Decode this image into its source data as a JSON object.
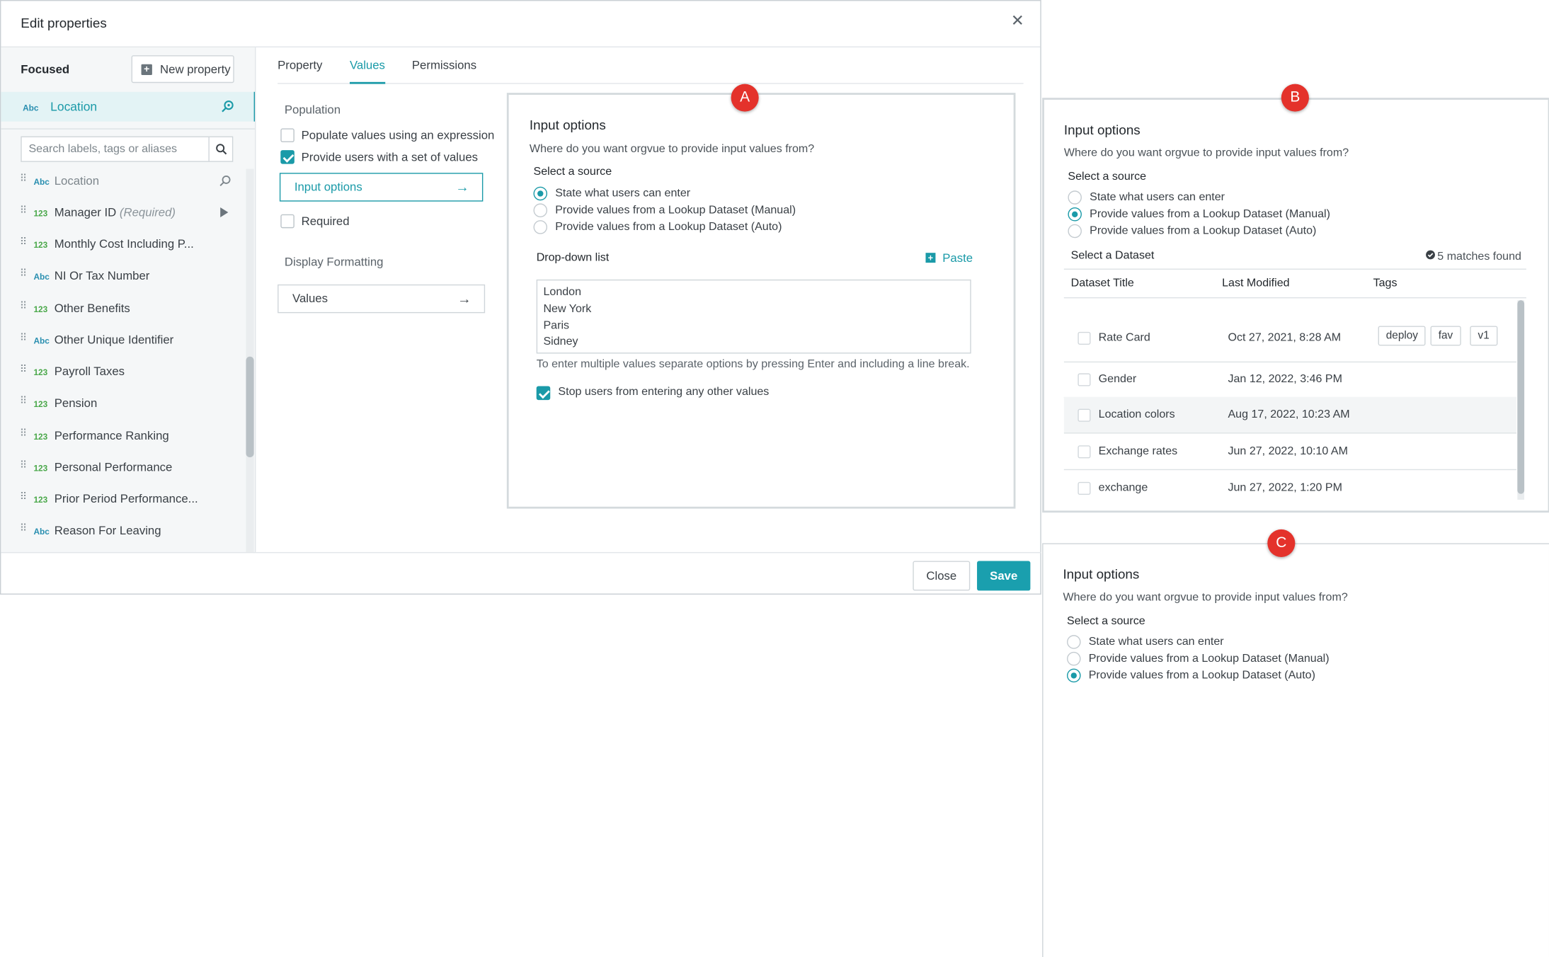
{
  "dialog": {
    "title": "Edit properties",
    "close_glyph": "✕"
  },
  "sidebar": {
    "focused_label": "Focused",
    "new_property_label": "New property",
    "focused_item": {
      "type": "Abc",
      "name": "Location"
    },
    "search_placeholder": "Search labels, tags or aliases",
    "items": [
      {
        "type": "Abc",
        "name": "Location",
        "muted": true
      },
      {
        "type": "123",
        "name": "Manager ID",
        "suffix": "(Required)"
      },
      {
        "type": "123",
        "name": "Monthly Cost Including P..."
      },
      {
        "type": "Abc",
        "name": "NI Or Tax Number"
      },
      {
        "type": "123",
        "name": "Other Benefits"
      },
      {
        "type": "Abc",
        "name": "Other Unique Identifier"
      },
      {
        "type": "123",
        "name": "Payroll Taxes"
      },
      {
        "type": "123",
        "name": "Pension"
      },
      {
        "type": "123",
        "name": "Performance Ranking"
      },
      {
        "type": "123",
        "name": "Personal Performance"
      },
      {
        "type": "123",
        "name": "Prior Period Performance..."
      },
      {
        "type": "Abc",
        "name": "Reason For Leaving"
      }
    ]
  },
  "tabs": [
    "Property",
    "Values",
    "Permissions"
  ],
  "active_tab": "Values",
  "population": {
    "title": "Population",
    "expression_label": "Populate values using an expression",
    "set_label": "Provide users with a set of values",
    "input_options_btn": "Input options",
    "required_label": "Required",
    "display_formatting_title": "Display Formatting",
    "values_btn": "Values"
  },
  "panel_a": {
    "marker": "A",
    "title": "Input options",
    "subtitle": "Where do you want orgvue to provide input values from?",
    "source_label": "Select a source",
    "options": [
      "State what users can enter",
      "Provide values from a Lookup Dataset (Manual)",
      "Provide values from a Lookup Dataset (Auto)"
    ],
    "selected_index": 0,
    "dropdown_label": "Drop-down list",
    "paste_label": "Paste",
    "dropdown_values": [
      "London",
      "New York",
      "Paris",
      "Sidney"
    ],
    "hint": "To enter multiple values separate options by pressing Enter and including a line break.",
    "stop_label": "Stop users from entering any other values"
  },
  "panel_b": {
    "marker": "B",
    "title": "Input options",
    "subtitle": "Where do you want orgvue to provide input values from?",
    "source_label": "Select a source",
    "options": [
      "State what users can enter",
      "Provide values from a Lookup Dataset (Manual)",
      "Provide values from a Lookup Dataset (Auto)"
    ],
    "selected_index": 1,
    "dataset_label": "Select a Dataset",
    "matches": "5 matches found",
    "columns": [
      "Dataset Title",
      "Last Modified",
      "Tags"
    ],
    "rows": [
      {
        "title": "Rate Card",
        "modified": "Oct 27, 2021, 8:28 AM",
        "tags": [
          "deploy",
          "fav",
          "v1"
        ]
      },
      {
        "title": "Gender",
        "modified": "Jan 12, 2022, 3:46 PM",
        "tags": []
      },
      {
        "title": "Location colors",
        "modified": "Aug 17, 2022, 10:23 AM",
        "tags": []
      },
      {
        "title": "Exchange rates",
        "modified": "Jun 27, 2022, 10:10 AM",
        "tags": []
      },
      {
        "title": "exchange",
        "modified": "Jun 27, 2022, 1:20 PM",
        "tags": []
      }
    ]
  },
  "panel_c": {
    "marker": "C",
    "title": "Input options",
    "subtitle": "Where do you want orgvue to provide input values from?",
    "source_label": "Select a source",
    "options": [
      "State what users can enter",
      "Provide values from a Lookup Dataset (Manual)",
      "Provide values from a Lookup Dataset (Auto)"
    ],
    "selected_index": 2
  },
  "footer": {
    "close_label": "Close",
    "save_label": "Save"
  },
  "colors": {
    "accent": "#1a9aa8",
    "marker": "#e4322b",
    "abc_type": "#2a8fb0",
    "num_type": "#4aa84a"
  }
}
